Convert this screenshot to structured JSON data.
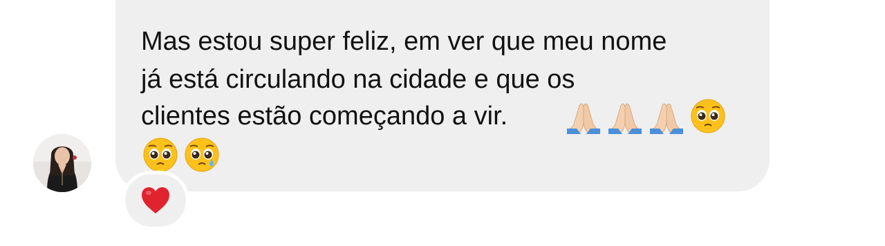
{
  "message": {
    "line1": "Mas estou super feliz, em ver que meu nome",
    "line2": "já está circulando na cidade e que os",
    "line3": "clientes estão começando a vir.",
    "emojis": [
      "folded-hands",
      "folded-hands",
      "folded-hands",
      "pleading-face",
      "pleading-face",
      "pleading-face-tear"
    ]
  },
  "reaction": {
    "emoji": "red-heart"
  },
  "colors": {
    "bubble": "#efefef",
    "text": "#111111",
    "heart": "#e0242e"
  }
}
